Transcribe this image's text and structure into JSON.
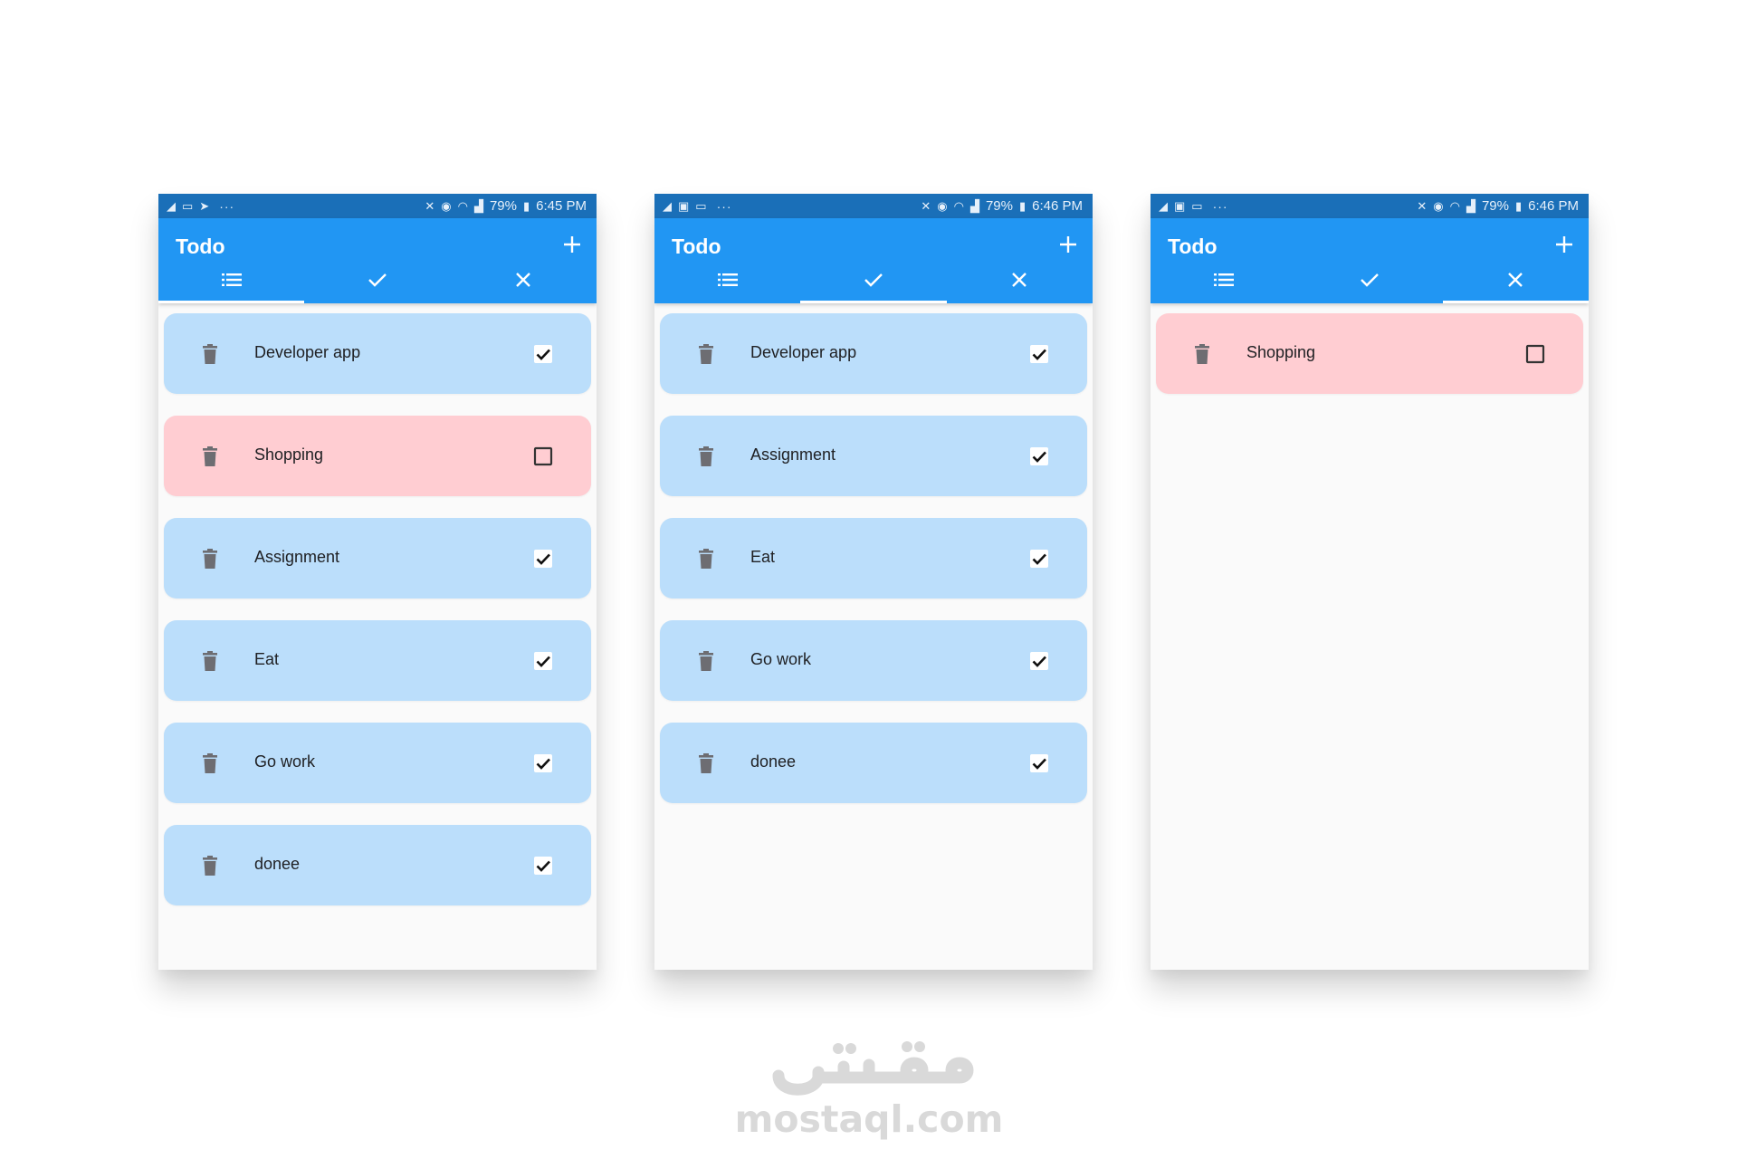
{
  "screens": [
    {
      "statusbar": {
        "battery": "79%",
        "time": "6:45 PM"
      },
      "appbar": {
        "title": "Todo",
        "add_icon": "plus-icon"
      },
      "tabs": [
        {
          "icon": "list-icon",
          "active": true
        },
        {
          "icon": "check-icon",
          "active": false
        },
        {
          "icon": "close-icon",
          "active": false
        }
      ],
      "items": [
        {
          "label": "Developer app",
          "done": true
        },
        {
          "label": "Shopping",
          "done": false
        },
        {
          "label": "Assignment",
          "done": true
        },
        {
          "label": "Eat",
          "done": true
        },
        {
          "label": "Go work",
          "done": true
        },
        {
          "label": "donee",
          "done": true
        }
      ]
    },
    {
      "statusbar": {
        "battery": "79%",
        "time": "6:46 PM"
      },
      "appbar": {
        "title": "Todo",
        "add_icon": "plus-icon"
      },
      "tabs": [
        {
          "icon": "list-icon",
          "active": false
        },
        {
          "icon": "check-icon",
          "active": true
        },
        {
          "icon": "close-icon",
          "active": false
        }
      ],
      "items": [
        {
          "label": "Developer app",
          "done": true
        },
        {
          "label": "Assignment",
          "done": true
        },
        {
          "label": "Eat",
          "done": true
        },
        {
          "label": "Go work",
          "done": true
        },
        {
          "label": "donee",
          "done": true
        }
      ]
    },
    {
      "statusbar": {
        "battery": "79%",
        "time": "6:46 PM"
      },
      "appbar": {
        "title": "Todo",
        "add_icon": "plus-icon"
      },
      "tabs": [
        {
          "icon": "list-icon",
          "active": false
        },
        {
          "icon": "check-icon",
          "active": false
        },
        {
          "icon": "close-icon",
          "active": true
        }
      ],
      "items": [
        {
          "label": "Shopping",
          "done": false
        }
      ]
    }
  ],
  "colors": {
    "statusbar": "#1a6fb8",
    "appbar": "#2196f3",
    "done_card": "#bbdefb",
    "pending_card": "#ffcdd2",
    "background": "#fafafa"
  },
  "watermark": {
    "arabic_logo": "مستقل",
    "domain": "mostaql.com"
  }
}
